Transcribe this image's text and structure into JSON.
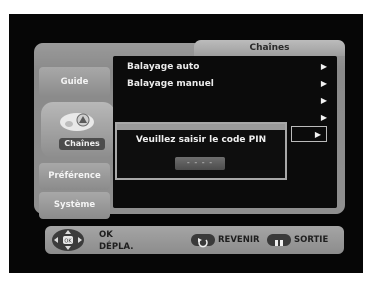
{
  "header": {
    "title": "Chaînes"
  },
  "sidebar": {
    "items": [
      {
        "label": "Guide"
      },
      {
        "label": "Chaînes"
      },
      {
        "label": "Préférence"
      },
      {
        "label": "Système"
      }
    ]
  },
  "menu": {
    "items": [
      {
        "label": "Balayage auto",
        "arrow": "▶"
      },
      {
        "label": "Balayage manuel",
        "arrow": "▶"
      },
      {
        "label": "",
        "arrow": "▶"
      },
      {
        "label": "",
        "arrow": "▶"
      },
      {
        "label": "",
        "arrow": "▶"
      }
    ]
  },
  "dialog": {
    "message": "Veuillez saisir le code PIN",
    "pin_placeholder": "- - - -"
  },
  "footer": {
    "ok_label": "OK",
    "move_label": "DÉPLA.",
    "back_label": "REVENIR",
    "exit_label": "SORTIE",
    "back_icon": "rewind-icon",
    "exit_icon": "pause-icon",
    "nav_icon": "dpad-icon"
  },
  "colors": {
    "panel": "#8f8f8f",
    "content": "#0b0b0b",
    "text_light": "#ececec",
    "text_dark": "#1e1e1e"
  }
}
